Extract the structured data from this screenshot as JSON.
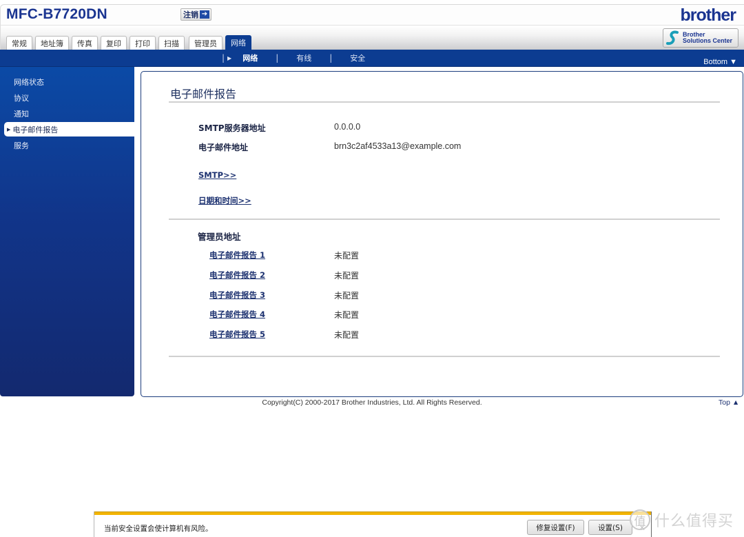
{
  "header": {
    "model": "MFC-B7720DN",
    "logout_label": "注销",
    "logout_icon": "arrow-right-icon",
    "brand_logo": "brother",
    "solutions_center": [
      "Brother",
      "Solutions Center"
    ],
    "tabs": [
      {
        "label": "常规",
        "active": false
      },
      {
        "label": "地址簿",
        "active": false
      },
      {
        "label": "传真",
        "active": false
      },
      {
        "label": "复印",
        "active": false
      },
      {
        "label": "打印",
        "active": false
      },
      {
        "label": "扫描",
        "active": false
      },
      {
        "label": "管理员",
        "active": false
      },
      {
        "label": "网络",
        "active": true
      }
    ]
  },
  "subnav": {
    "items": [
      "网络",
      "有线",
      "安全"
    ],
    "active": "网络",
    "bottom_link": "Bottom ▼"
  },
  "sidebar": {
    "items": [
      {
        "label": "网络状态",
        "active": false
      },
      {
        "label": "协议",
        "active": false
      },
      {
        "label": "通知",
        "active": false
      },
      {
        "label": "电子邮件报告",
        "active": true
      },
      {
        "label": "服务",
        "active": false
      }
    ]
  },
  "main": {
    "title": "电子邮件报告",
    "fields": [
      {
        "label": "SMTP服务器地址",
        "value": "0.0.0.0"
      },
      {
        "label": "电子邮件地址",
        "value": "brn3c2af4533a13@example.com"
      }
    ],
    "links": [
      "SMTP>>",
      "日期和时间>>"
    ],
    "admin_section_label": "管理员地址",
    "reports": [
      {
        "label": "电子邮件报告 1",
        "value": "未配置"
      },
      {
        "label": "电子邮件报告 2",
        "value": "未配置"
      },
      {
        "label": "电子邮件报告 3",
        "value": "未配置"
      },
      {
        "label": "电子邮件报告 4",
        "value": "未配置"
      },
      {
        "label": "电子邮件报告 5",
        "value": "未配置"
      }
    ]
  },
  "footer": {
    "copyright": "Copyright(C) 2000-2017 Brother Industries, Ltd. All Rights Reserved.",
    "top_link": "Top ▲"
  },
  "notification_bar": {
    "message": "当前安全设置会使计算机有风险。",
    "fix_button": "修复设置(F)",
    "settings_button": "设置(S)",
    "close": "×"
  },
  "watermark": {
    "badge": "值",
    "text": "什么值得买"
  },
  "colors": {
    "brand_blue": "#1b3591",
    "nav_blue": "#0c3c91",
    "warning_yellow": "#f2b400"
  }
}
